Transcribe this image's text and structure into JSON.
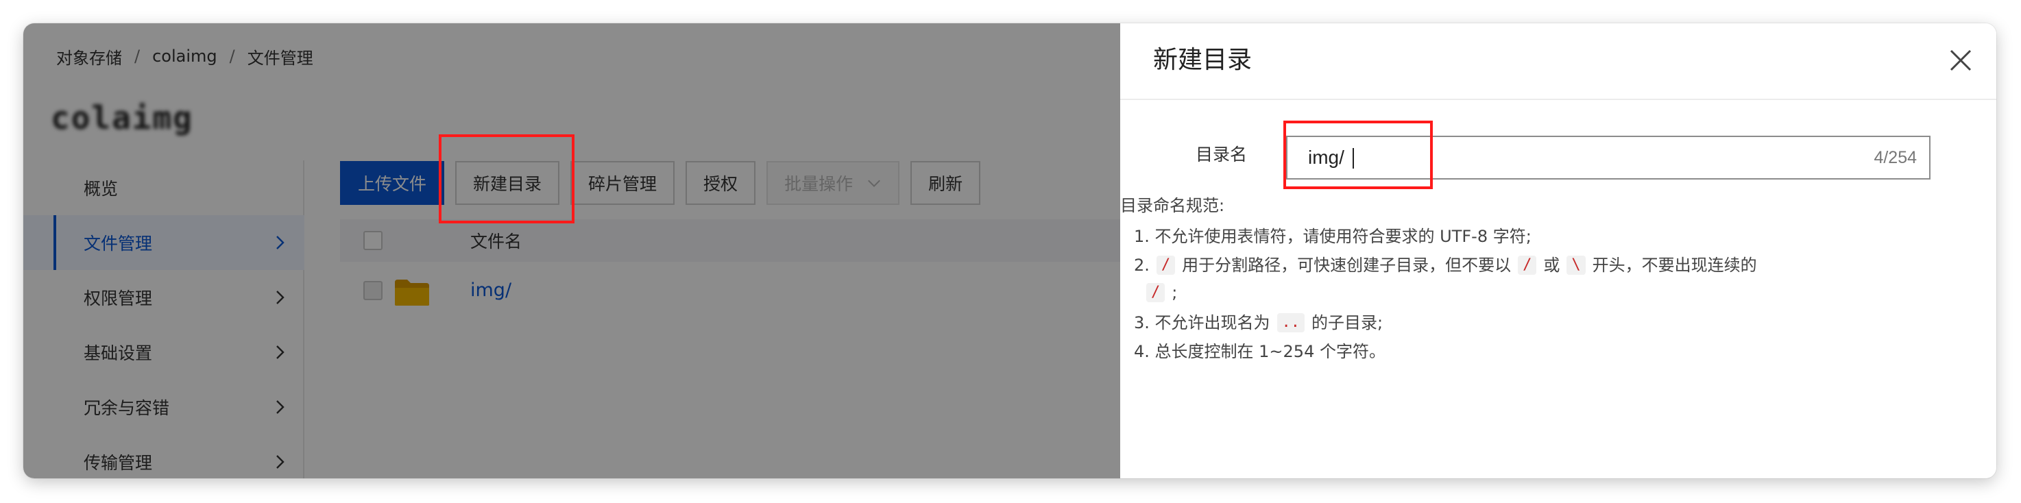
{
  "breadcrumb": {
    "items": [
      "对象存储",
      "colaimg",
      "文件管理"
    ],
    "separator": "/"
  },
  "bucket": {
    "title": "colaimg"
  },
  "sidebar": {
    "items": [
      {
        "label": "概览",
        "active": false,
        "has_chevron": false
      },
      {
        "label": "文件管理",
        "active": true,
        "has_chevron": true
      },
      {
        "label": "权限管理",
        "active": false,
        "has_chevron": true
      },
      {
        "label": "基础设置",
        "active": false,
        "has_chevron": true
      },
      {
        "label": "冗余与容错",
        "active": false,
        "has_chevron": true
      },
      {
        "label": "传输管理",
        "active": false,
        "has_chevron": true
      }
    ]
  },
  "toolbar": {
    "upload_label": "上传文件",
    "new_folder_label": "新建目录",
    "fragments_label": "碎片管理",
    "authorize_label": "授权",
    "batch_label": "批量操作",
    "refresh_label": "刷新"
  },
  "table": {
    "columns": [
      "文件名"
    ],
    "rows": [
      {
        "name": "img/",
        "type": "folder"
      }
    ]
  },
  "drawer": {
    "title": "新建目录",
    "field_label": "目录名",
    "input_value": "img/",
    "counter": "4/254",
    "rules_title": "目录命名规范:",
    "rules": {
      "r1": "1. 不允许使用表情符，请使用符合要求的 UTF-8 字符;",
      "r2_prefix": "2.",
      "r2_code1": "/",
      "r2_text1": "用于分割路径，可快速创建子目录，但不要以",
      "r2_code2": "/",
      "r2_or": "或",
      "r2_code3": "\\",
      "r2_text2": "开头，不要出现连续的",
      "r2_code4": "/",
      "r2_end": ";",
      "r3_prefix": "3. 不允许出现名为",
      "r3_code": "..",
      "r3_suffix": "的子目录;",
      "r4": "4. 总长度控制在 1~254 个字符。"
    }
  },
  "colors": {
    "brand": "#0b58d6",
    "highlight": "#ff1a1a",
    "code_text": "#c62828",
    "folder": "#f5b800"
  },
  "icons": [
    "chevron-right-icon",
    "chevron-down-icon",
    "folder-icon",
    "close-icon"
  ]
}
